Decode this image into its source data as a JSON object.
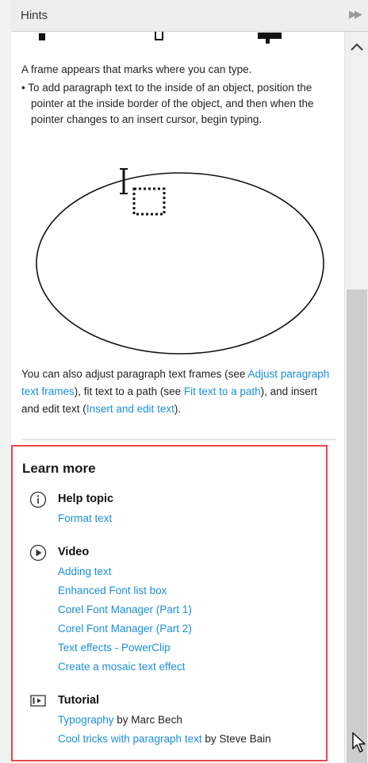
{
  "panel": {
    "title": "Hints",
    "dock_icon": "double-chevron-right-icon"
  },
  "hint": {
    "intro": "A frame appears that marks where you can type.",
    "bullet": "• To add paragraph text to the inside of an object, position the pointer at the inside border of the object, and then when the pointer changes to an insert cursor, begin typing.",
    "also_prefix": "You can also adjust paragraph text frames (see ",
    "link_adjust": "Adjust paragraph text frames",
    "also_mid1": "), fit text to a path (see ",
    "link_fit": "Fit text to a path",
    "also_mid2": "), and insert and edit text (",
    "link_insert": "Insert and edit text",
    "also_suffix": ")."
  },
  "learn_more": {
    "title": "Learn more",
    "help_topic": {
      "heading": "Help topic",
      "icon": "info-icon",
      "links": [
        "Format text"
      ]
    },
    "video": {
      "heading": "Video",
      "icon": "play-icon",
      "links": [
        "Adding text",
        "Enhanced Font list box",
        "Corel Font Manager (Part 1)",
        "Corel Font Manager (Part 2)",
        "Text effects - PowerClip",
        "Create a mosaic text effect"
      ]
    },
    "tutorial": {
      "heading": "Tutorial",
      "icon": "tutorial-icon",
      "items": [
        {
          "link": "Typography",
          "suffix": " by Marc Bech"
        },
        {
          "link": "Cool tricks with paragraph text",
          "suffix": " by Steve Bain"
        }
      ]
    }
  },
  "colors": {
    "link": "#1b8fd4",
    "highlight_border": "#e8484d",
    "header_bg": "#eeeeee"
  }
}
